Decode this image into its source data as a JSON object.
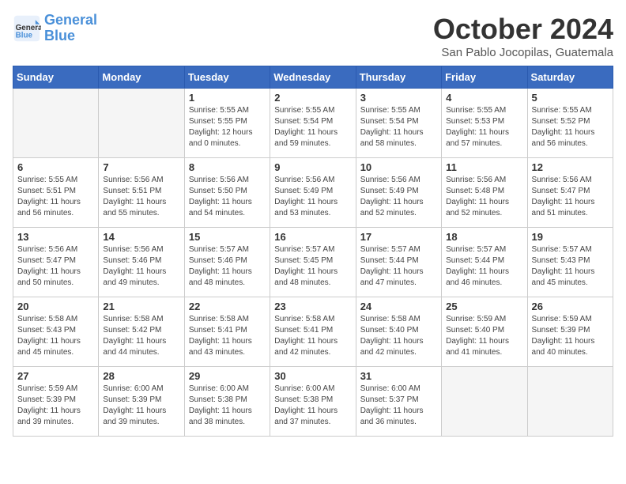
{
  "logo": {
    "line1": "General",
    "line2": "Blue"
  },
  "title": "October 2024",
  "location": "San Pablo Jocopilas, Guatemala",
  "days_of_week": [
    "Sunday",
    "Monday",
    "Tuesday",
    "Wednesday",
    "Thursday",
    "Friday",
    "Saturday"
  ],
  "weeks": [
    [
      {
        "day": "",
        "info": ""
      },
      {
        "day": "",
        "info": ""
      },
      {
        "day": "1",
        "info": "Sunrise: 5:55 AM\nSunset: 5:55 PM\nDaylight: 12 hours\nand 0 minutes."
      },
      {
        "day": "2",
        "info": "Sunrise: 5:55 AM\nSunset: 5:54 PM\nDaylight: 11 hours\nand 59 minutes."
      },
      {
        "day": "3",
        "info": "Sunrise: 5:55 AM\nSunset: 5:54 PM\nDaylight: 11 hours\nand 58 minutes."
      },
      {
        "day": "4",
        "info": "Sunrise: 5:55 AM\nSunset: 5:53 PM\nDaylight: 11 hours\nand 57 minutes."
      },
      {
        "day": "5",
        "info": "Sunrise: 5:55 AM\nSunset: 5:52 PM\nDaylight: 11 hours\nand 56 minutes."
      }
    ],
    [
      {
        "day": "6",
        "info": "Sunrise: 5:55 AM\nSunset: 5:51 PM\nDaylight: 11 hours\nand 56 minutes."
      },
      {
        "day": "7",
        "info": "Sunrise: 5:56 AM\nSunset: 5:51 PM\nDaylight: 11 hours\nand 55 minutes."
      },
      {
        "day": "8",
        "info": "Sunrise: 5:56 AM\nSunset: 5:50 PM\nDaylight: 11 hours\nand 54 minutes."
      },
      {
        "day": "9",
        "info": "Sunrise: 5:56 AM\nSunset: 5:49 PM\nDaylight: 11 hours\nand 53 minutes."
      },
      {
        "day": "10",
        "info": "Sunrise: 5:56 AM\nSunset: 5:49 PM\nDaylight: 11 hours\nand 52 minutes."
      },
      {
        "day": "11",
        "info": "Sunrise: 5:56 AM\nSunset: 5:48 PM\nDaylight: 11 hours\nand 52 minutes."
      },
      {
        "day": "12",
        "info": "Sunrise: 5:56 AM\nSunset: 5:47 PM\nDaylight: 11 hours\nand 51 minutes."
      }
    ],
    [
      {
        "day": "13",
        "info": "Sunrise: 5:56 AM\nSunset: 5:47 PM\nDaylight: 11 hours\nand 50 minutes."
      },
      {
        "day": "14",
        "info": "Sunrise: 5:56 AM\nSunset: 5:46 PM\nDaylight: 11 hours\nand 49 minutes."
      },
      {
        "day": "15",
        "info": "Sunrise: 5:57 AM\nSunset: 5:46 PM\nDaylight: 11 hours\nand 48 minutes."
      },
      {
        "day": "16",
        "info": "Sunrise: 5:57 AM\nSunset: 5:45 PM\nDaylight: 11 hours\nand 48 minutes."
      },
      {
        "day": "17",
        "info": "Sunrise: 5:57 AM\nSunset: 5:44 PM\nDaylight: 11 hours\nand 47 minutes."
      },
      {
        "day": "18",
        "info": "Sunrise: 5:57 AM\nSunset: 5:44 PM\nDaylight: 11 hours\nand 46 minutes."
      },
      {
        "day": "19",
        "info": "Sunrise: 5:57 AM\nSunset: 5:43 PM\nDaylight: 11 hours\nand 45 minutes."
      }
    ],
    [
      {
        "day": "20",
        "info": "Sunrise: 5:58 AM\nSunset: 5:43 PM\nDaylight: 11 hours\nand 45 minutes."
      },
      {
        "day": "21",
        "info": "Sunrise: 5:58 AM\nSunset: 5:42 PM\nDaylight: 11 hours\nand 44 minutes."
      },
      {
        "day": "22",
        "info": "Sunrise: 5:58 AM\nSunset: 5:41 PM\nDaylight: 11 hours\nand 43 minutes."
      },
      {
        "day": "23",
        "info": "Sunrise: 5:58 AM\nSunset: 5:41 PM\nDaylight: 11 hours\nand 42 minutes."
      },
      {
        "day": "24",
        "info": "Sunrise: 5:58 AM\nSunset: 5:40 PM\nDaylight: 11 hours\nand 42 minutes."
      },
      {
        "day": "25",
        "info": "Sunrise: 5:59 AM\nSunset: 5:40 PM\nDaylight: 11 hours\nand 41 minutes."
      },
      {
        "day": "26",
        "info": "Sunrise: 5:59 AM\nSunset: 5:39 PM\nDaylight: 11 hours\nand 40 minutes."
      }
    ],
    [
      {
        "day": "27",
        "info": "Sunrise: 5:59 AM\nSunset: 5:39 PM\nDaylight: 11 hours\nand 39 minutes."
      },
      {
        "day": "28",
        "info": "Sunrise: 6:00 AM\nSunset: 5:39 PM\nDaylight: 11 hours\nand 39 minutes."
      },
      {
        "day": "29",
        "info": "Sunrise: 6:00 AM\nSunset: 5:38 PM\nDaylight: 11 hours\nand 38 minutes."
      },
      {
        "day": "30",
        "info": "Sunrise: 6:00 AM\nSunset: 5:38 PM\nDaylight: 11 hours\nand 37 minutes."
      },
      {
        "day": "31",
        "info": "Sunrise: 6:00 AM\nSunset: 5:37 PM\nDaylight: 11 hours\nand 36 minutes."
      },
      {
        "day": "",
        "info": ""
      },
      {
        "day": "",
        "info": ""
      }
    ]
  ]
}
